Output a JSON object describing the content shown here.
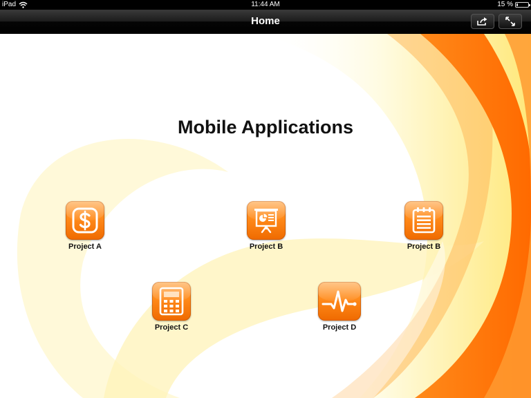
{
  "status_bar": {
    "device": "iPad",
    "time": "11:44 AM",
    "battery": "15 %",
    "battery_level": 0.15
  },
  "nav_bar": {
    "title": "Home",
    "share_icon": "share-icon",
    "expand_icon": "expand-icon"
  },
  "page": {
    "title": "Mobile Applications"
  },
  "apps": [
    {
      "label": "Project A",
      "icon": "dollar-icon"
    },
    {
      "label": "Project B",
      "icon": "presentation-icon"
    },
    {
      "label": "Project B",
      "icon": "notepad-icon"
    },
    {
      "label": "Project C",
      "icon": "calculator-icon"
    },
    {
      "label": "Project D",
      "icon": "heartbeat-icon"
    }
  ],
  "colors": {
    "accent_orange": "#ff7a00",
    "background": "#ffffff",
    "nav_bar": "#1c1c1c"
  }
}
